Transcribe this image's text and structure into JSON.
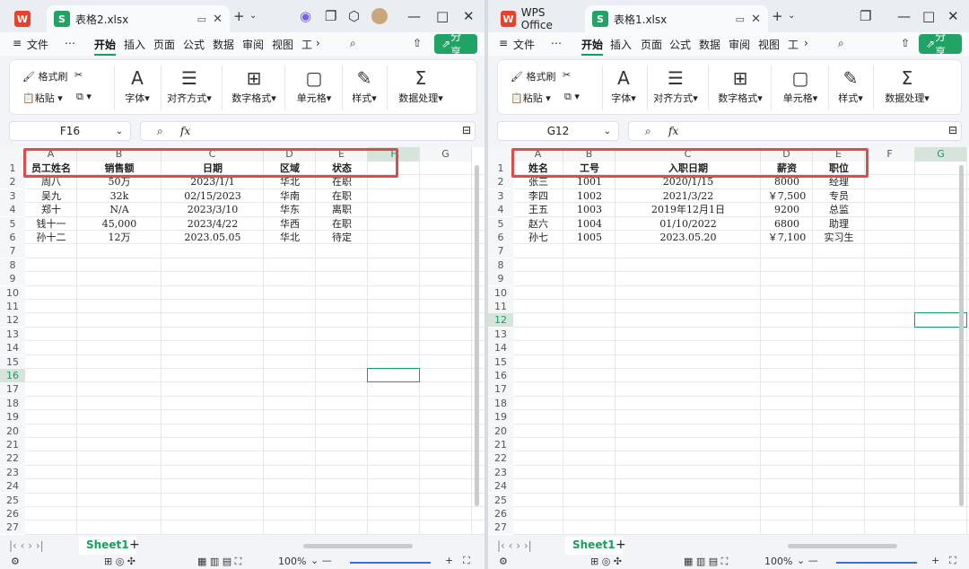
{
  "windows": [
    {
      "id": "L",
      "tabs": {
        "home": "",
        "doc": "表格2.xlsx"
      },
      "menu": {
        "file": "文件",
        "more": "⋯",
        "items": [
          "开始",
          "插入",
          "页面",
          "公式",
          "数据",
          "审阅",
          "视图",
          "工"
        ],
        "share": "分享"
      },
      "ribbon": {
        "format_painter": "格式刷",
        "paste": "粘贴",
        "font": "字体",
        "align": "对齐方式",
        "numfmt": "数字格式",
        "cell": "单元格",
        "style": "样式",
        "dataproc": "数据处理"
      },
      "namebox": "F16",
      "fx": "fx",
      "columns": [
        "A",
        "B",
        "C",
        "D",
        "E",
        "F",
        "G"
      ],
      "rows": [
        "1",
        "2",
        "3",
        "4",
        "5",
        "6",
        "7",
        "8",
        "9",
        "10",
        "11",
        "12",
        "13",
        "14",
        "15",
        "16",
        "17",
        "18",
        "19",
        "20",
        "21",
        "22",
        "23",
        "24",
        "25",
        "26",
        "27"
      ],
      "cells": [
        [
          "员工姓名",
          "销售额",
          "日期",
          "区域",
          "状态"
        ],
        [
          "周八",
          "50万",
          "2023/1/1",
          "华北",
          "在职"
        ],
        [
          "吴九",
          "32k",
          "02/15/2023",
          "华南",
          "在职"
        ],
        [
          "郑十",
          "N/A",
          "2023/3/10",
          "华东",
          "离职"
        ],
        [
          "钱十一",
          "45,000",
          "2023/4/22",
          "华西",
          "在职"
        ],
        [
          "孙十二",
          "12万",
          "2023.05.05",
          "华北",
          "待定"
        ]
      ],
      "sheet": "Sheet1",
      "zoom": "100%"
    },
    {
      "id": "R",
      "tabs": {
        "home": "WPS Office",
        "doc": "表格1.xlsx"
      },
      "menu": {
        "file": "文件",
        "more": "⋯",
        "items": [
          "开始",
          "插入",
          "页面",
          "公式",
          "数据",
          "审阅",
          "视图",
          "工"
        ],
        "share": "分享"
      },
      "ribbon": {
        "format_painter": "格式刷",
        "paste": "粘贴",
        "font": "字体",
        "align": "对齐方式",
        "numfmt": "数字格式",
        "cell": "单元格",
        "style": "样式",
        "dataproc": "数据处理"
      },
      "namebox": "G12",
      "fx": "fx",
      "columns": [
        "A",
        "B",
        "C",
        "D",
        "E",
        "F",
        "G"
      ],
      "rows": [
        "1",
        "2",
        "3",
        "4",
        "5",
        "6",
        "7",
        "8",
        "9",
        "10",
        "11",
        "12",
        "13",
        "14",
        "15",
        "16",
        "17",
        "18",
        "19",
        "20",
        "21",
        "22",
        "23",
        "24",
        "25",
        "26",
        "27"
      ],
      "cells": [
        [
          "姓名",
          "工号",
          "入职日期",
          "薪资",
          "职位"
        ],
        [
          "张三",
          "1001",
          "2020/1/15",
          "8000",
          "经理"
        ],
        [
          "李四",
          "1002",
          "2021/3/22",
          "￥7,500",
          "专员"
        ],
        [
          "王五",
          "1003",
          "2019年12月1日",
          "9200",
          "总监"
        ],
        [
          "赵六",
          "1004",
          "01/10/2022",
          "6800",
          "助理"
        ],
        [
          "孙七",
          "1005",
          "2023.05.20",
          "￥7,100",
          "实习生"
        ]
      ],
      "sheet": "Sheet1",
      "zoom": "100%"
    }
  ],
  "colors": {
    "accent": "#14a05c",
    "highlight": "#e14a4a",
    "wps_red": "#e8412c",
    "sheet_green": "#21a366"
  },
  "icons": [
    "wps-logo-icon",
    "sheet-app-icon",
    "close-icon",
    "new-tab-icon",
    "format-painter-icon",
    "scissors-icon",
    "paste-icon",
    "copy-icon",
    "font-icon",
    "align-icon",
    "number-format-icon",
    "cell-icon",
    "style-icon",
    "sum-icon",
    "search-icon",
    "upload-icon",
    "fx-icon",
    "zoom-icon"
  ]
}
